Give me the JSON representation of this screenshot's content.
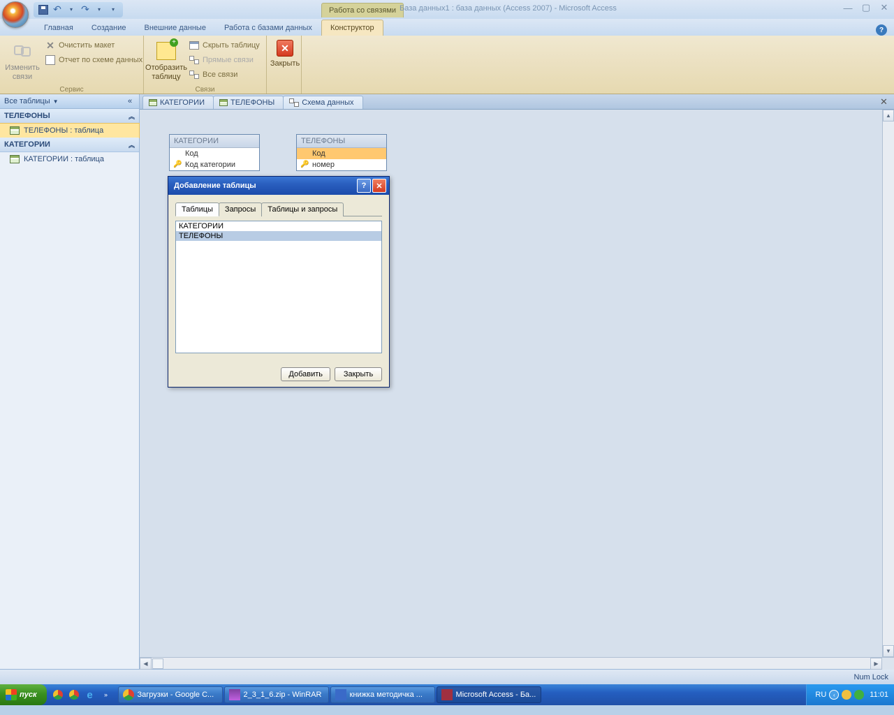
{
  "title": {
    "context_tab": "Работа со связями",
    "db_title": "База данных1 : база данных (Access 2007) - Microsoft Access"
  },
  "ribbon_tabs": [
    "Главная",
    "Создание",
    "Внешние данные",
    "Работа с базами данных",
    "Конструктор"
  ],
  "ribbon": {
    "group1": {
      "big_btn": "Изменить связи",
      "clear": "Очистить макет",
      "report": "Отчет по схеме данных",
      "label": "Сервис"
    },
    "group2": {
      "show_table": "Отобразить таблицу",
      "hide_table": "Скрыть таблицу",
      "direct": "Прямые связи",
      "all": "Все связи",
      "label": "Связи"
    },
    "close": "Закрыть"
  },
  "nav": {
    "header": "Все таблицы",
    "sections": [
      {
        "head": "ТЕЛЕФОНЫ",
        "items": [
          "ТЕЛЕФОНЫ : таблица"
        ]
      },
      {
        "head": "КАТЕГОРИИ",
        "items": [
          "КАТЕГОРИИ : таблица"
        ]
      }
    ]
  },
  "doc_tabs": [
    "КАТЕГОРИИ",
    "ТЕЛЕФОНЫ",
    "Схема данных"
  ],
  "canvas": {
    "box1": {
      "title": "КАТЕГОРИИ",
      "fields": [
        "Код",
        "Код категории"
      ]
    },
    "box2": {
      "title": "ТЕЛЕФОНЫ",
      "fields": [
        "Код",
        "номер"
      ]
    }
  },
  "dialog": {
    "title": "Добавление таблицы",
    "tabs": [
      "Таблицы",
      "Запросы",
      "Таблицы и запросы"
    ],
    "list": [
      "КАТЕГОРИИ",
      "ТЕЛЕФОНЫ"
    ],
    "btn_add": "Добавить",
    "btn_close": "Закрыть"
  },
  "status": {
    "numlock": "Num Lock"
  },
  "taskbar": {
    "start": "пуск",
    "items": [
      "Загрузки - Google C...",
      "2_3_1_6.zip - WinRAR",
      "книжка методичка ...",
      "Microsoft Access - Ба..."
    ],
    "lang": "RU",
    "clock": "11:01"
  }
}
